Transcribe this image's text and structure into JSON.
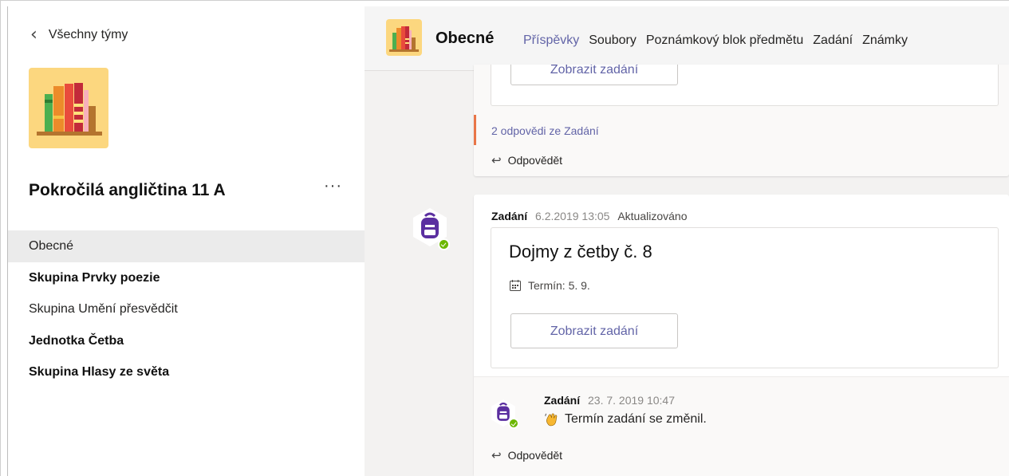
{
  "sidebar": {
    "back_label": "Všechny týmy",
    "team_name": "Pokročilá angličtina 11 A",
    "more_label": "···",
    "channels": [
      {
        "label": "Obecné"
      },
      {
        "label": "Skupina Prvky poezie"
      },
      {
        "label": "Skupina Umění přesvědčit"
      },
      {
        "label": "Jednotka Četba"
      },
      {
        "label": "Skupina Hlasy ze světa"
      }
    ]
  },
  "header": {
    "title": "Obecné",
    "tabs": [
      "Příspěvky",
      "Soubory",
      "Poznámkový blok předmětu",
      "Zadání",
      "Známky"
    ]
  },
  "thread1": {
    "button": "Zobrazit zadání",
    "replies_link": "2 odpovědi ze Zadání",
    "reply": "Odpovědět"
  },
  "post2": {
    "author": "Zadání",
    "time": "6.2.2019 13:05",
    "status": "Aktualizováno",
    "assignment_title": "Dojmy z četby č. 8",
    "due": "Termín: 5. 9.",
    "button": "Zobrazit zadání"
  },
  "reply2": {
    "author": "Zadání",
    "time": "23. 7. 2019 10:47",
    "message": "Termín zadání se změnil.",
    "reply": "Odpovědět"
  },
  "colors": {
    "accent": "#6264a7",
    "avatar": "#5b2fa0",
    "presence": "#6bb700",
    "reply_bar": "#e97548"
  }
}
